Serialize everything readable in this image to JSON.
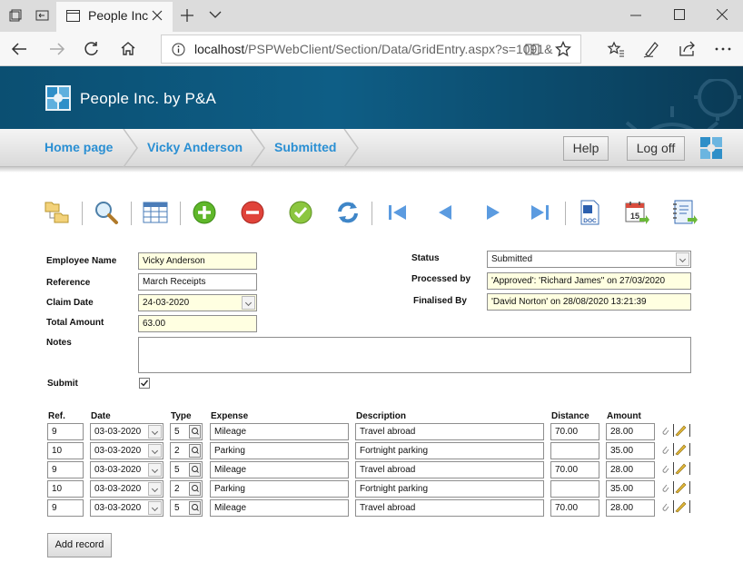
{
  "browser": {
    "tab_title": "People Inc",
    "url_host": "localhost",
    "url_path": "/PSPWebClient/Section/Data/GridEntry.aspx?s=1091&"
  },
  "app": {
    "title": "People Inc. by P&A"
  },
  "nav": {
    "crumbs": [
      "Home page",
      "Vicky Anderson",
      "Submitted"
    ],
    "help_label": "Help",
    "logoff_label": "Log off"
  },
  "toolbar": {
    "icons": [
      "folders-icon",
      "search-icon",
      "grid-icon",
      "add-icon",
      "remove-icon",
      "approve-icon",
      "refresh-icon",
      "first-record-icon",
      "previous-record-icon",
      "next-record-icon",
      "last-record-icon",
      "word-doc-icon",
      "calendar-export-icon",
      "notebook-export-icon"
    ],
    "calendar_day": "15",
    "doc_label": "DOC"
  },
  "form": {
    "employee_name_label": "Employee Name",
    "employee_name": "Vicky Anderson",
    "reference_label": "Reference",
    "reference": "March Receipts",
    "claim_date_label": "Claim Date",
    "claim_date": "24-03-2020",
    "total_amount_label": "Total Amount",
    "total_amount": "63.00",
    "notes_label": "Notes",
    "notes": "",
    "submit_label": "Submit",
    "submit_checked": true,
    "status_label": "Status",
    "status": "Submitted",
    "processed_by_label": "Processed by",
    "processed_by": "'Approved': 'Richard James\" on 27/03/2020",
    "finalised_by_label": "Finalised By",
    "finalised_by": "'David Norton' on 28/08/2020 13:21:39"
  },
  "grid": {
    "headers": {
      "ref": "Ref.",
      "date": "Date",
      "type": "Type",
      "expense": "Expense",
      "description": "Description",
      "distance": "Distance",
      "amount": "Amount"
    },
    "rows": [
      {
        "ref": "9",
        "date": "03-03-2020",
        "type": "5",
        "expense": "Mileage",
        "description": "Travel abroad",
        "distance": "70.00",
        "amount": "28.00"
      },
      {
        "ref": "10",
        "date": "03-03-2020",
        "type": "2",
        "expense": "Parking",
        "description": "Fortnight parking",
        "distance": "",
        "amount": "35.00"
      },
      {
        "ref": "9",
        "date": "03-03-2020",
        "type": "5",
        "expense": "Mileage",
        "description": "Travel abroad",
        "distance": "70.00",
        "amount": "28.00"
      },
      {
        "ref": "10",
        "date": "03-03-2020",
        "type": "2",
        "expense": "Parking",
        "description": "Fortnight parking",
        "distance": "",
        "amount": "35.00"
      },
      {
        "ref": "9",
        "date": "03-03-2020",
        "type": "5",
        "expense": "Mileage",
        "description": "Travel abroad",
        "distance": "70.00",
        "amount": "28.00"
      }
    ],
    "add_record_label": "Add record"
  },
  "colors": {
    "header_blue": "#0e5e86",
    "crumb_blue": "#2a8fd3",
    "field_yellow": "#ffffe1"
  }
}
